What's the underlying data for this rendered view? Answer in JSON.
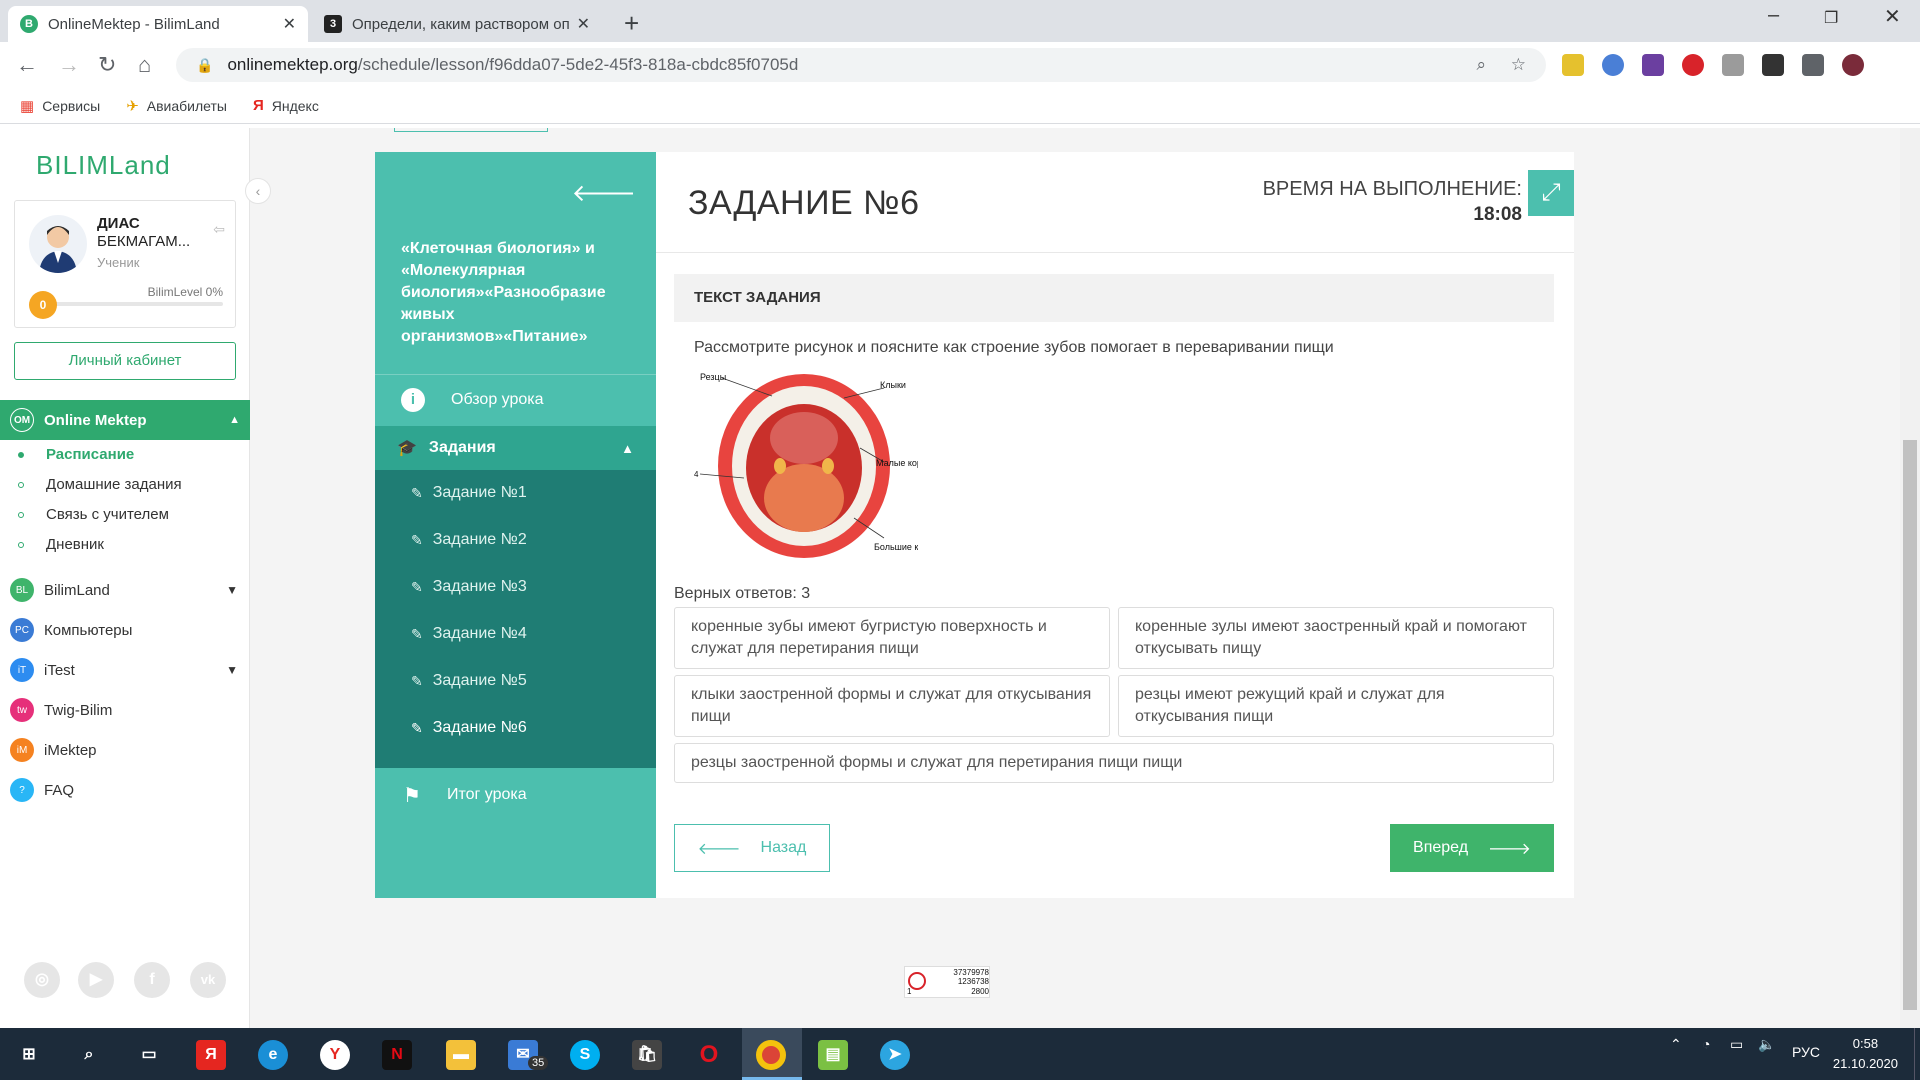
{
  "browser": {
    "tabs": [
      {
        "title": "OnlineMektep - BilimLand",
        "active": true
      },
      {
        "title": "Определи, каким раствором оп",
        "active": false
      }
    ],
    "url_host": "onlinemektep.org",
    "url_path": "/schedule/lesson/f96dda07-5de2-45f3-818a-cbdc85f0705d",
    "bookmarks": [
      "Сервисы",
      "Авиабилеты",
      "Яндекс"
    ]
  },
  "sidebar": {
    "logo": "BILIMLand",
    "user_first": "ДИАС",
    "user_last": "БЕКМАГАМ...",
    "role": "Ученик",
    "level_label": "BilimLevel 0%",
    "level": "0",
    "cabinet": "Личный кабинет",
    "online_mektep": "Online Mektep",
    "sub_items": [
      "Расписание",
      "Домашние задания",
      "Связь с учителем",
      "Дневник"
    ],
    "sections": [
      "BilimLand",
      "Компьютеры",
      "iTest",
      "Twig-Bilim",
      "iMektep",
      "FAQ"
    ]
  },
  "lesson": {
    "title": "«Клеточная биология» и «Молекулярная биология»«Разнообразие живых организмов»«Питание»",
    "overview": "Обзор урока",
    "tasks_header": "Задания",
    "tasks": [
      "Задание №1",
      "Задание №2",
      "Задание №3",
      "Задание №4",
      "Задание №5",
      "Задание №6"
    ],
    "result": "Итог урока"
  },
  "task": {
    "title": "ЗАДАНИЕ №6",
    "time_label": "ВРЕМЯ НА ВЫПОЛНЕНИЕ:",
    "time_value": "18:08",
    "text_header": "ТЕКСТ ЗАДАНИЯ",
    "question": "Рассмотрите рисунок и поясните как строение зубов помогает в переваривании пищи",
    "image_labels": {
      "l1": "Резцы",
      "l2": "Клыки",
      "l3": "Малые коренные",
      "l4": "Большие коренные",
      "l5": "4"
    },
    "correct_count": "Верных ответов: 3",
    "options": [
      "коренные зубы имеют бугристую поверхность и служат для перетирания пищи",
      "коренные зулы имеют заостренный край и помогают откусывать пищу",
      "клыки заостренной формы и служат для откусывания пищи",
      "резцы имеют режущий край и служат для откусывания пищи",
      "резцы заостренной формы и служат для перетирания пищи пищи"
    ],
    "back": "Назад",
    "next": "Вперед"
  },
  "counter": {
    "v1": "37379978",
    "v2": "1236738",
    "v3": "2800",
    "v4": "1"
  },
  "taskbar": {
    "mail_badge": "35",
    "lang": "РУС",
    "time": "0:58",
    "date": "21.10.2020"
  }
}
